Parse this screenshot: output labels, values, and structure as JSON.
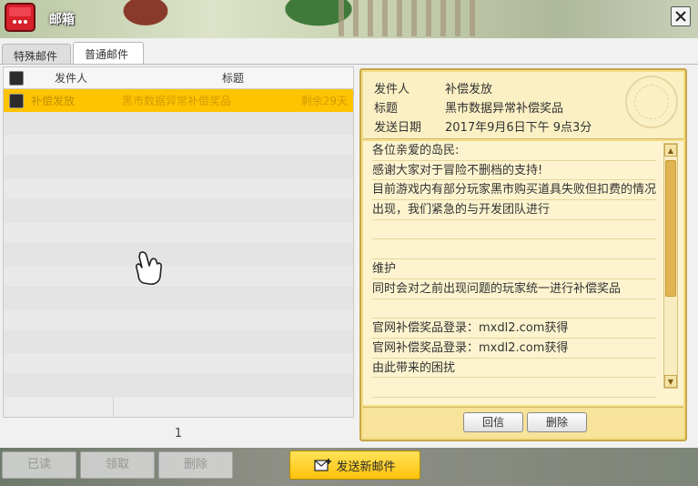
{
  "window": {
    "title": "邮箱",
    "close_label": "✕"
  },
  "tabs": [
    {
      "label": "特殊邮件",
      "active": false
    },
    {
      "label": "普通邮件",
      "active": true
    }
  ],
  "list": {
    "headers": {
      "sender": "发件人",
      "subject": "标题"
    },
    "selected_mail": {
      "sender": "补偿发放",
      "subject": "黑市数据异常补偿奖品",
      "remaining": "剩余29天"
    },
    "page": "1"
  },
  "detail": {
    "sender_label": "发件人",
    "sender_value": "补偿发放",
    "subject_label": "标题",
    "subject_value": "黑市数据异常补偿奖品",
    "date_label": "发送日期",
    "date_value": "2017年9月6日下午 9点3分",
    "body": [
      "各位亲爱的岛民:",
      "感谢大家对于冒险不删档的支持!",
      "目前游戏内有部分玩家黑市购买道具失败但扣费的情况",
      "出现，我们紧急的与开发团队进行",
      "",
      "",
      "维护",
      "同时会对之前出现问题的玩家统一进行补偿奖品",
      "",
      "官网补偿奖品登录：mxdl2.com获得",
      "官网补偿奖品登录：mxdl2.com获得",
      "由此带来的困扰",
      ""
    ],
    "reply_label": "回信",
    "delete_label": "删除"
  },
  "bottom": {
    "mark_read_label": "已读",
    "receive_label": "领取",
    "delete_label": "删除",
    "send_label": "发送新邮件"
  },
  "colors": {
    "selected_row": "#ffc400",
    "detail_bg": "#f4dd83",
    "send_button": "#ffc20a"
  },
  "icons": [
    "mailbox-icon",
    "close-icon",
    "envelope-plus-icon",
    "hand-cursor-icon",
    "stamp-icon"
  ]
}
